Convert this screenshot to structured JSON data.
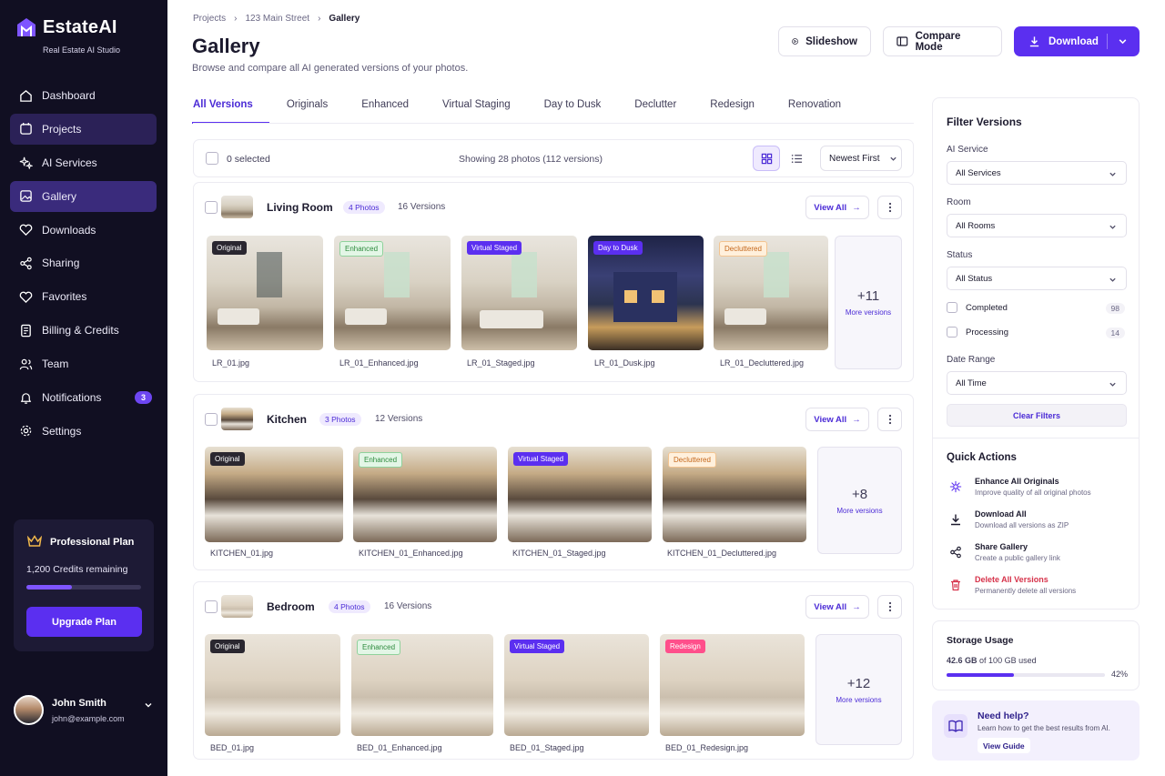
{
  "app": {
    "name": "EstateAI",
    "tagline": "Real Estate AI Studio",
    "accent": "#5b2ff0",
    "sidebar_bg": "#110f22"
  },
  "sidebar": {
    "items": [
      {
        "label": "Dashboard",
        "icon": "home-icon"
      },
      {
        "label": "Projects",
        "icon": "folder-icon"
      },
      {
        "label": "AI Services",
        "icon": "sparkle-icon"
      },
      {
        "label": "Gallery",
        "icon": "image-icon"
      },
      {
        "label": "Downloads",
        "icon": "heart-icon"
      },
      {
        "label": "Sharing",
        "icon": "share-icon"
      },
      {
        "label": "Favorites",
        "icon": "heart-icon"
      },
      {
        "label": "Billing & Credits",
        "icon": "billing-icon"
      },
      {
        "label": "Team",
        "icon": "team-icon"
      },
      {
        "label": "Notifications",
        "icon": "bell-icon",
        "badge": "3"
      },
      {
        "label": "Settings",
        "icon": "gear-icon"
      }
    ],
    "plan": {
      "name": "Professional Plan",
      "credits": "1,200 Credits remaining",
      "progress": 0.4,
      "button": "Upgrade Plan"
    },
    "user": {
      "name": "John Smith",
      "email": "john@example.com"
    }
  },
  "breadcrumb": {
    "items": [
      "Projects",
      "123 Main Street",
      "Gallery"
    ]
  },
  "page": {
    "title": "Gallery",
    "subtitle": "Browse and compare all AI generated versions of your photos."
  },
  "actions": {
    "slideshow": "Slideshow",
    "compare": "Compare Mode",
    "download": "Download"
  },
  "tabs": [
    "All Versions",
    "Originals",
    "Enhanced",
    "Virtual Staging",
    "Day to Dusk",
    "Declutter",
    "Redesign",
    "Renovation"
  ],
  "toolbar": {
    "selected": "0 selected",
    "showing": "Showing 28 photos (112 versions)",
    "sort": "Newest First"
  },
  "groups": [
    {
      "title": "Living Room",
      "photos_badge": "4 Photos",
      "versions": "16 Versions",
      "view_all": "View All",
      "items": [
        {
          "tag": "Original",
          "file": "LR_01.jpg"
        },
        {
          "tag": "Enhanced",
          "file": "LR_01_Enhanced.jpg"
        },
        {
          "tag": "Virtual Staged",
          "file": "LR_01_Staged.jpg"
        },
        {
          "tag": "Day to Dusk",
          "file": "LR_01_Dusk.jpg"
        },
        {
          "tag": "Decluttered",
          "file": "LR_01_Decluttered.jpg"
        }
      ],
      "more": {
        "count": "+11",
        "label": "More versions"
      }
    },
    {
      "title": "Kitchen",
      "photos_badge": "3 Photos",
      "versions": "12 Versions",
      "view_all": "View All",
      "items": [
        {
          "tag": "Original",
          "file": "KITCHEN_01.jpg"
        },
        {
          "tag": "Enhanced",
          "file": "KITCHEN_01_Enhanced.jpg"
        },
        {
          "tag": "Virtual Staged",
          "file": "KITCHEN_01_Staged.jpg"
        },
        {
          "tag": "Decluttered",
          "file": "KITCHEN_01_Decluttered.jpg"
        }
      ],
      "more": {
        "count": "+8",
        "label": "More versions"
      }
    },
    {
      "title": "Bedroom",
      "photos_badge": "4 Photos",
      "versions": "16 Versions",
      "view_all": "View All",
      "items": [
        {
          "tag": "Original",
          "file": "BED_01.jpg"
        },
        {
          "tag": "Enhanced",
          "file": "BED_01_Enhanced.jpg"
        },
        {
          "tag": "Virtual Staged",
          "file": "BED_01_Staged.jpg"
        },
        {
          "tag": "Redesign",
          "file": "BED_01_Redesign.jpg"
        }
      ],
      "more": {
        "count": "+12",
        "label": "More versions"
      }
    }
  ],
  "filters": {
    "title": "Filter Versions",
    "service": {
      "label": "AI Service",
      "value": "All Services"
    },
    "room": {
      "label": "Room",
      "value": "All Rooms"
    },
    "status": {
      "label": "Status",
      "value": "All Status"
    },
    "completed": {
      "label": "Completed",
      "count": "98"
    },
    "processing": {
      "label": "Processing",
      "count": "14"
    },
    "date": {
      "label": "Date Range",
      "value": "All Time"
    },
    "clear": "Clear Filters"
  },
  "quick_actions": {
    "title": "Quick Actions",
    "items": [
      {
        "title": "Enhance All Originals",
        "desc": "Improve quality of all original photos"
      },
      {
        "title": "Download All",
        "desc": "Download all versions as ZIP"
      },
      {
        "title": "Share Gallery",
        "desc": "Create a public gallery link"
      },
      {
        "title": "Delete All Versions",
        "desc": "Permanently delete all versions"
      }
    ]
  },
  "storage": {
    "title": "Storage Usage",
    "used": "42.6 GB",
    "of": "of 100 GB used",
    "percent": "42%",
    "fraction": 0.426
  },
  "help": {
    "title": "Need help?",
    "desc": "Learn how to get the best results from AI.",
    "button": "View Guide"
  }
}
